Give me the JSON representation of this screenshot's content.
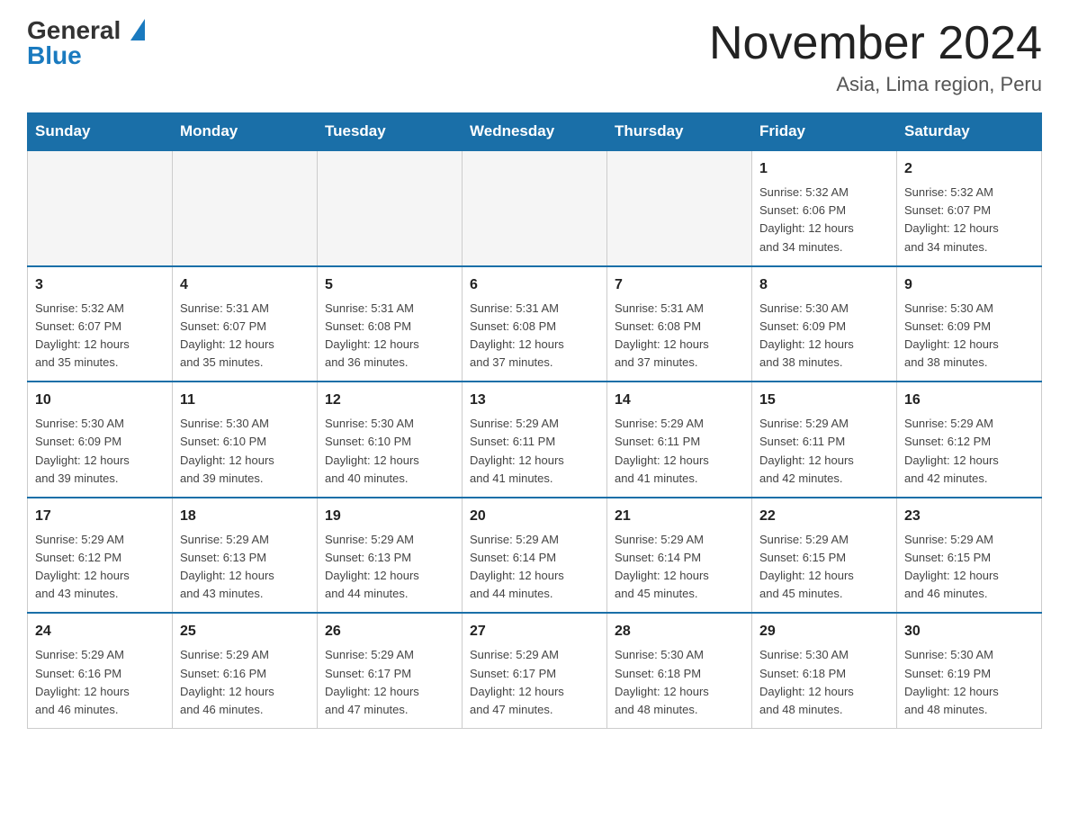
{
  "logo": {
    "general": "General",
    "blue": "Blue"
  },
  "title": "November 2024",
  "subtitle": "Asia, Lima region, Peru",
  "weekdays": [
    "Sunday",
    "Monday",
    "Tuesday",
    "Wednesday",
    "Thursday",
    "Friday",
    "Saturday"
  ],
  "weeks": [
    [
      {
        "day": "",
        "info": ""
      },
      {
        "day": "",
        "info": ""
      },
      {
        "day": "",
        "info": ""
      },
      {
        "day": "",
        "info": ""
      },
      {
        "day": "",
        "info": ""
      },
      {
        "day": "1",
        "info": "Sunrise: 5:32 AM\nSunset: 6:06 PM\nDaylight: 12 hours\nand 34 minutes."
      },
      {
        "day": "2",
        "info": "Sunrise: 5:32 AM\nSunset: 6:07 PM\nDaylight: 12 hours\nand 34 minutes."
      }
    ],
    [
      {
        "day": "3",
        "info": "Sunrise: 5:32 AM\nSunset: 6:07 PM\nDaylight: 12 hours\nand 35 minutes."
      },
      {
        "day": "4",
        "info": "Sunrise: 5:31 AM\nSunset: 6:07 PM\nDaylight: 12 hours\nand 35 minutes."
      },
      {
        "day": "5",
        "info": "Sunrise: 5:31 AM\nSunset: 6:08 PM\nDaylight: 12 hours\nand 36 minutes."
      },
      {
        "day": "6",
        "info": "Sunrise: 5:31 AM\nSunset: 6:08 PM\nDaylight: 12 hours\nand 37 minutes."
      },
      {
        "day": "7",
        "info": "Sunrise: 5:31 AM\nSunset: 6:08 PM\nDaylight: 12 hours\nand 37 minutes."
      },
      {
        "day": "8",
        "info": "Sunrise: 5:30 AM\nSunset: 6:09 PM\nDaylight: 12 hours\nand 38 minutes."
      },
      {
        "day": "9",
        "info": "Sunrise: 5:30 AM\nSunset: 6:09 PM\nDaylight: 12 hours\nand 38 minutes."
      }
    ],
    [
      {
        "day": "10",
        "info": "Sunrise: 5:30 AM\nSunset: 6:09 PM\nDaylight: 12 hours\nand 39 minutes."
      },
      {
        "day": "11",
        "info": "Sunrise: 5:30 AM\nSunset: 6:10 PM\nDaylight: 12 hours\nand 39 minutes."
      },
      {
        "day": "12",
        "info": "Sunrise: 5:30 AM\nSunset: 6:10 PM\nDaylight: 12 hours\nand 40 minutes."
      },
      {
        "day": "13",
        "info": "Sunrise: 5:29 AM\nSunset: 6:11 PM\nDaylight: 12 hours\nand 41 minutes."
      },
      {
        "day": "14",
        "info": "Sunrise: 5:29 AM\nSunset: 6:11 PM\nDaylight: 12 hours\nand 41 minutes."
      },
      {
        "day": "15",
        "info": "Sunrise: 5:29 AM\nSunset: 6:11 PM\nDaylight: 12 hours\nand 42 minutes."
      },
      {
        "day": "16",
        "info": "Sunrise: 5:29 AM\nSunset: 6:12 PM\nDaylight: 12 hours\nand 42 minutes."
      }
    ],
    [
      {
        "day": "17",
        "info": "Sunrise: 5:29 AM\nSunset: 6:12 PM\nDaylight: 12 hours\nand 43 minutes."
      },
      {
        "day": "18",
        "info": "Sunrise: 5:29 AM\nSunset: 6:13 PM\nDaylight: 12 hours\nand 43 minutes."
      },
      {
        "day": "19",
        "info": "Sunrise: 5:29 AM\nSunset: 6:13 PM\nDaylight: 12 hours\nand 44 minutes."
      },
      {
        "day": "20",
        "info": "Sunrise: 5:29 AM\nSunset: 6:14 PM\nDaylight: 12 hours\nand 44 minutes."
      },
      {
        "day": "21",
        "info": "Sunrise: 5:29 AM\nSunset: 6:14 PM\nDaylight: 12 hours\nand 45 minutes."
      },
      {
        "day": "22",
        "info": "Sunrise: 5:29 AM\nSunset: 6:15 PM\nDaylight: 12 hours\nand 45 minutes."
      },
      {
        "day": "23",
        "info": "Sunrise: 5:29 AM\nSunset: 6:15 PM\nDaylight: 12 hours\nand 46 minutes."
      }
    ],
    [
      {
        "day": "24",
        "info": "Sunrise: 5:29 AM\nSunset: 6:16 PM\nDaylight: 12 hours\nand 46 minutes."
      },
      {
        "day": "25",
        "info": "Sunrise: 5:29 AM\nSunset: 6:16 PM\nDaylight: 12 hours\nand 46 minutes."
      },
      {
        "day": "26",
        "info": "Sunrise: 5:29 AM\nSunset: 6:17 PM\nDaylight: 12 hours\nand 47 minutes."
      },
      {
        "day": "27",
        "info": "Sunrise: 5:29 AM\nSunset: 6:17 PM\nDaylight: 12 hours\nand 47 minutes."
      },
      {
        "day": "28",
        "info": "Sunrise: 5:30 AM\nSunset: 6:18 PM\nDaylight: 12 hours\nand 48 minutes."
      },
      {
        "day": "29",
        "info": "Sunrise: 5:30 AM\nSunset: 6:18 PM\nDaylight: 12 hours\nand 48 minutes."
      },
      {
        "day": "30",
        "info": "Sunrise: 5:30 AM\nSunset: 6:19 PM\nDaylight: 12 hours\nand 48 minutes."
      }
    ]
  ]
}
